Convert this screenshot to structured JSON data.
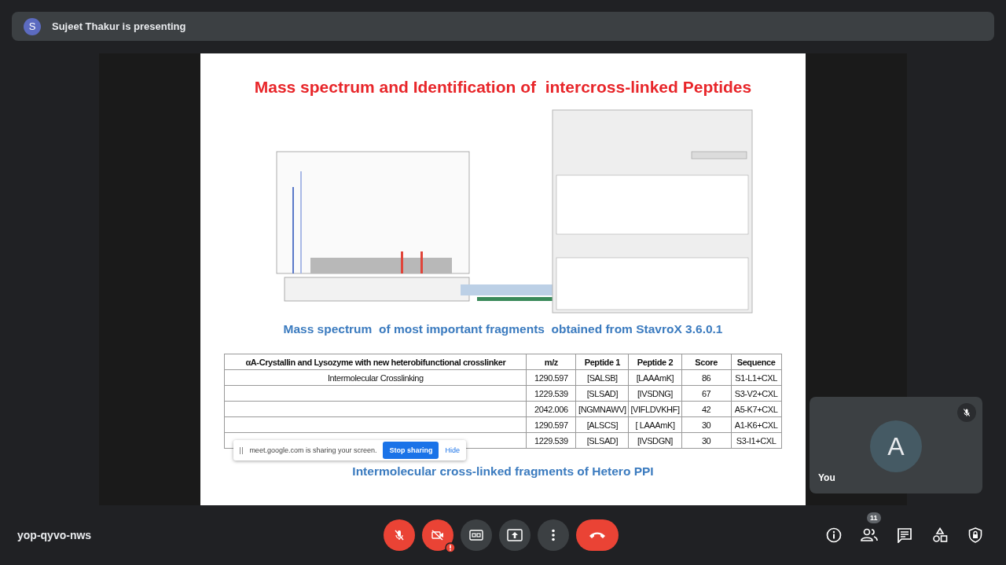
{
  "meeting": {
    "presenter_initial": "S",
    "presenter_banner": "Sujeet Thakur is presenting",
    "code": "yop-qyvo-nws",
    "participant_count": "11"
  },
  "controls": [
    {
      "kind": "mic",
      "on": false
    },
    {
      "kind": "camera",
      "on": false,
      "warning": true
    },
    {
      "kind": "captions"
    },
    {
      "kind": "present"
    },
    {
      "kind": "more"
    },
    {
      "kind": "leave"
    }
  ],
  "side_actions": [
    {
      "kind": "info"
    },
    {
      "kind": "people"
    },
    {
      "kind": "chat"
    },
    {
      "kind": "activities"
    },
    {
      "kind": "host"
    }
  ],
  "self_tile": {
    "initial": "A",
    "label": "You",
    "muted": true
  },
  "slide": {
    "title": "Mass spectrum and Identification of  intercross-linked Peptides",
    "caption_1": "Mass spectrum  of most important fragments  obtained from StavroX 3.6.0.1",
    "table": {
      "columns": [
        "αA-Crystallin and Lysozyme with new heterobifunctional crosslinker",
        "m/z",
        "Peptide 1",
        "Peptide 2",
        "Score",
        "Sequence"
      ],
      "rows": [
        {
          "label": "Intermolecular Crosslinking",
          "mz": "1290.597",
          "peptide_1": "[SALSB]",
          "peptide_2": "[LAAAmK]",
          "score": "86",
          "sequence": "S1-L1+CXL"
        },
        {
          "mz": "1229.539",
          "peptide_1": "[SLSAD]",
          "peptide_2": "[IVSDNG]",
          "score": "67",
          "sequence": "S3-V2+CXL"
        },
        {
          "mz": "2042.006",
          "peptide_1": "[NGMNAWV]",
          "peptide_2": "[VIFLDVKHF]",
          "score": "42",
          "sequence": "A5-K7+CXL"
        },
        {
          "mz": "1290.597",
          "peptide_1": "[ALSCS]",
          "peptide_2": "[ LAAAmK]",
          "score": "30",
          "sequence": "A1-K6+CXL"
        },
        {
          "mz": "1229.539",
          "peptide_1": "[SLSAD]",
          "peptide_2": "[IVSDGN]",
          "score": "30",
          "sequence": "S3-I1+CXL"
        }
      ]
    },
    "caption_2": "Intermolecular cross-linked fragments of Hetero PPI",
    "share_bar": {
      "message": "meet.google.com is sharing your screen.",
      "stop": "Stop sharing",
      "hide": "Hide"
    }
  }
}
